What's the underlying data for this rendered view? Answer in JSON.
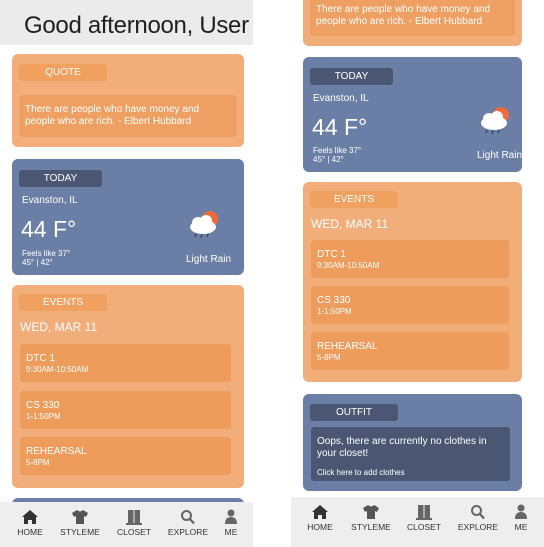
{
  "greeting": "Good afternoon, User",
  "quote": {
    "label": "QUOTE",
    "text": "There are people who have money and people who are rich. - Elbert Hubbard"
  },
  "weather": {
    "label": "TODAY",
    "location": "Evanston, IL",
    "temperature": "44 F°",
    "feels_like": "Feels like 37°",
    "high_low": "45° | 42°",
    "condition": "Light Rain",
    "icon": "rain-cloud-sun-icon"
  },
  "events": {
    "label": "EVENTS",
    "date": "WED, MAR 11",
    "items": [
      {
        "title": "DTC 1",
        "time": "9:30AM-10:50AM"
      },
      {
        "title": "CS 330",
        "time": "1-1:50PM"
      },
      {
        "title": "REHEARSAL",
        "time": "5-8PM"
      }
    ]
  },
  "outfit": {
    "label": "OUTFIT",
    "message": "Oops, there are currently no clothes in your closet!",
    "hint": "Click here to add clothes"
  },
  "nav": [
    {
      "label": "HOME",
      "icon": "home-icon"
    },
    {
      "label": "STYLEME",
      "icon": "tshirt-icon"
    },
    {
      "label": "CLOSET",
      "icon": "closet-icon"
    },
    {
      "label": "EXPLORE",
      "icon": "search-icon"
    },
    {
      "label": "ME",
      "icon": "person-icon"
    }
  ],
  "colors": {
    "orange_card": "#f1ae7a",
    "orange_accent": "#f0a05f",
    "blue_card": "#6b7fa6",
    "navy": "#4a5672"
  }
}
